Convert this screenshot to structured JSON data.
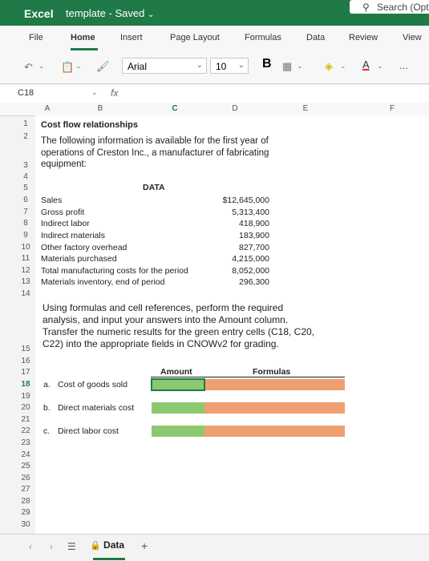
{
  "app": {
    "name": "Excel",
    "document_title": "template",
    "save_status": "Saved",
    "search_placeholder": "Search (Opt"
  },
  "menu": [
    "File",
    "Home",
    "Insert",
    "Page Layout",
    "Formulas",
    "Data",
    "Review",
    "View"
  ],
  "active_menu": "Home",
  "toolbar": {
    "font_name": "Arial",
    "font_size": "10",
    "bold_label": "B",
    "more_label": "..."
  },
  "formula_bar": {
    "name_box": "C18",
    "fx_label": "fx",
    "value": ""
  },
  "columns": [
    "A",
    "B",
    "C",
    "D",
    "E",
    "F"
  ],
  "rows": [
    "1",
    "2",
    "3",
    "4",
    "5",
    "6",
    "7",
    "8",
    "9",
    "10",
    "11",
    "12",
    "13",
    "14",
    "15",
    "16",
    "17",
    "18",
    "19",
    "20",
    "21",
    "22",
    "23",
    "24",
    "25",
    "26",
    "27",
    "28",
    "29",
    "30"
  ],
  "selected_row": "18",
  "sheet": {
    "title": "Cost flow relationships",
    "intro_line1": "The following information is available for the first year of",
    "intro_line2": "operations of Creston Inc., a manufacturer of fabricating",
    "intro_line3": "equipment:",
    "data_header": "DATA",
    "data_rows": [
      {
        "label": "Sales",
        "value": "$12,645,000"
      },
      {
        "label": "Gross profit",
        "value": "5,313,400"
      },
      {
        "label": "Indirect labor",
        "value": "418,900"
      },
      {
        "label": "Indirect materials",
        "value": "183,900"
      },
      {
        "label": "Other factory overhead",
        "value": "827,700"
      },
      {
        "label": "Materials purchased",
        "value": "4,215,000"
      },
      {
        "label": "Total manufacturing costs for the period",
        "value": "8,052,000"
      },
      {
        "label": "Materials inventory, end of period",
        "value": "296,300"
      }
    ],
    "instructions_line1": "Using formulas and cell references, perform the required",
    "instructions_line2": "analysis, and input your answers into the Amount column.",
    "instructions_line3": "Transfer the numeric results for the green entry cells (C18, C20,",
    "instructions_line4": "C22) into the appropriate fields in CNOWv2 for grading.",
    "amount_header": "Amount",
    "formulas_header": "Formulas",
    "questions": [
      {
        "letter": "a.",
        "label": "Cost of goods sold"
      },
      {
        "letter": "b.",
        "label": "Direct materials cost"
      },
      {
        "letter": "c.",
        "label": "Direct labor cost"
      }
    ]
  },
  "sheet_tabs": {
    "active": "Data",
    "add_label": "+"
  }
}
